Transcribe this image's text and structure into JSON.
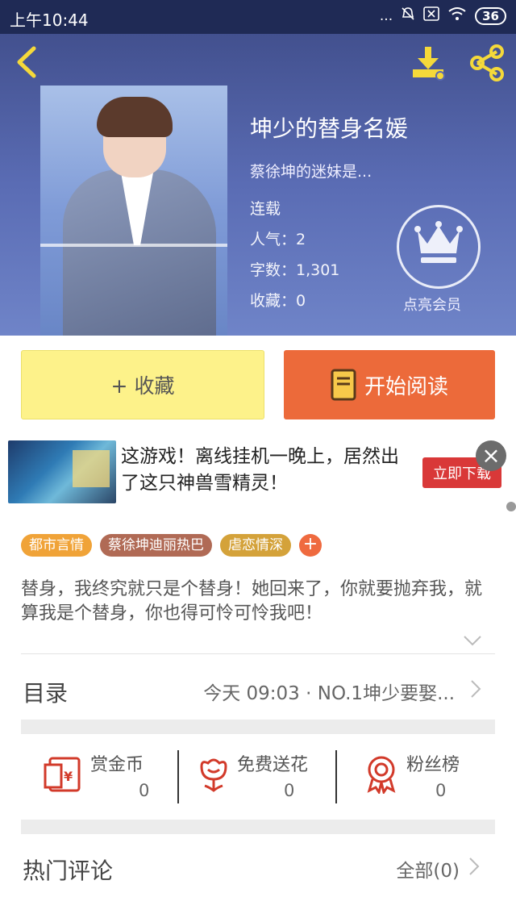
{
  "status_bar": {
    "time": "上午10:44",
    "signal": "...",
    "battery": "36"
  },
  "book": {
    "title": "坤少的替身名媛",
    "subtitle": "蔡徐坤的迷妹是...",
    "status": "连载",
    "popularity": "人气：2",
    "word_count": "字数：1,301",
    "favorites": "收藏：0"
  },
  "vip": {
    "label": "点亮会员"
  },
  "actions": {
    "favorite_label": "+ 收藏",
    "read_label": "开始阅读"
  },
  "ad": {
    "text": "这游戏！离线挂机一晚上，居然出了这只神兽雪精灵！",
    "cta": "立即下载"
  },
  "tags": [
    {
      "label": "都市言情",
      "color": "#f0a338"
    },
    {
      "label": "蔡徐坤迪丽热巴",
      "color": "#b06a55"
    },
    {
      "label": "虐恋情深",
      "color": "#d4a23a"
    }
  ],
  "description": "替身，我终究就只是个替身！她回来了，你就要抛弃我，就算我是个替身，你也得可怜可怜我吧！",
  "toc": {
    "label": "目录",
    "latest": "今天 09:03 · NO.1坤少要娶..."
  },
  "stats": [
    {
      "label": "赏金币",
      "value": "0",
      "icon": "red-envelope-icon"
    },
    {
      "label": "免费送花",
      "value": "0",
      "icon": "flower-icon"
    },
    {
      "label": "粉丝榜",
      "value": "0",
      "icon": "medal-icon"
    }
  ],
  "comments": {
    "label": "热门评论",
    "all_label": "全部(0)"
  },
  "colors": {
    "accent_orange": "#ec6a3a",
    "fav_yellow": "#fdf28a",
    "icon_red": "#d23a2a"
  }
}
